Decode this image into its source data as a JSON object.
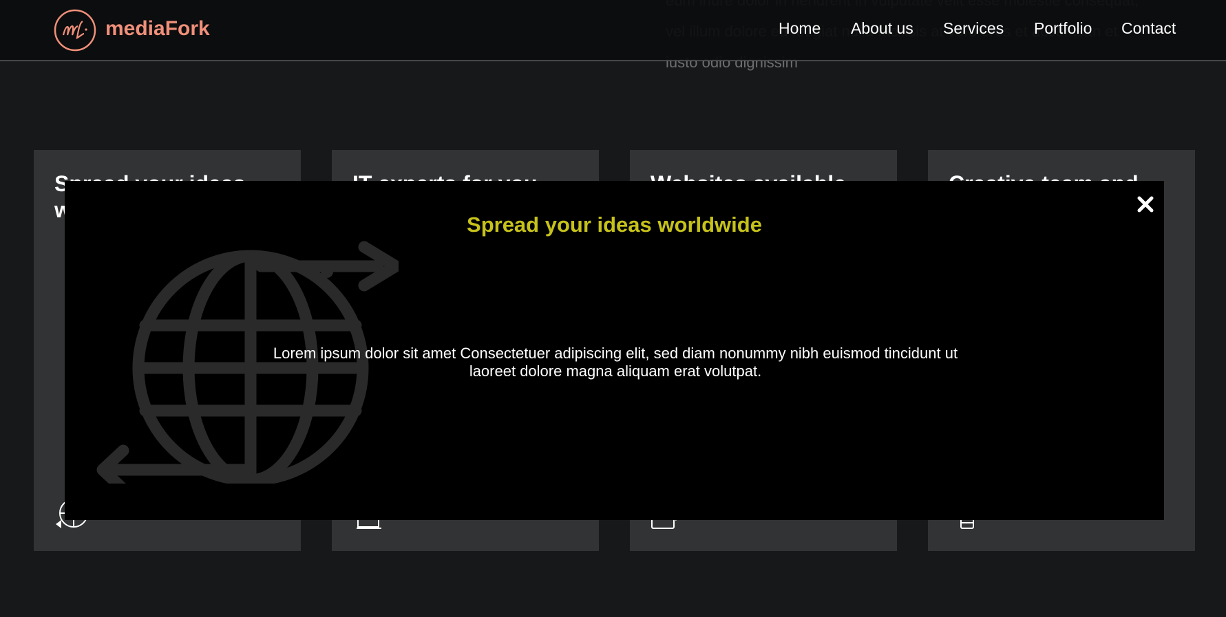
{
  "background_text": "eum iriure dolor in hendrerit in vulputate velit esse molestie consequat, vel illum dolore eu feugiat nulla facilisis at vero eros et accumsan et iusto odio dignissim",
  "header": {
    "logo_text": "mediaFork",
    "logo_icon": "mf-monogram-icon",
    "nav": [
      "Home",
      "About us",
      "Services",
      "Portfolio",
      "Contact"
    ]
  },
  "cards": [
    {
      "title": "Spread your ideas worldwide",
      "icon": "globe-arrows-icon"
    },
    {
      "title": "IT experts for you",
      "icon": "monitor-icon"
    },
    {
      "title": "Websites available",
      "icon": "devices-icon"
    },
    {
      "title": "Creative team and",
      "icon": "lightbulb-icon"
    }
  ],
  "modal": {
    "title": "Spread your ideas worldwide",
    "body": "Lorem ipsum dolor sit amet Consectetuer adipiscing elit, sed diam nonummy nibh euismod tincidunt ut laoreet dolore magna aliquam erat volutpat.",
    "close_icon": "close-icon",
    "background_icon": "globe-arrows-icon"
  },
  "colors": {
    "page_bg": "#17181a",
    "card_bg": "#323335",
    "accent_logo": "#f0907a",
    "modal_title": "#c6c21a"
  }
}
